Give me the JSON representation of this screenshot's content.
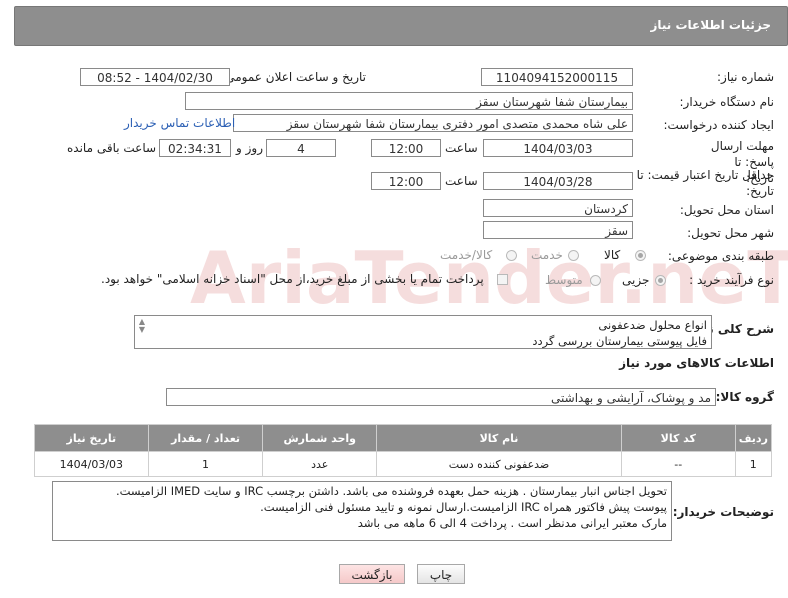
{
  "header": {
    "title": "جزئیات اطلاعات نیاز"
  },
  "fields": {
    "need_number_label": "شماره نیاز:",
    "need_number": "1104094152000115",
    "announce_label": "تاریخ و ساعت اعلان عمومی:",
    "announce_value": "1404/02/30 - 08:52",
    "buyer_org_label": "نام دستگاه خریدار:",
    "buyer_org": "بیمارستان شفا شهرستان سقز",
    "creator_label": "ایجاد کننده درخواست:",
    "creator": "علی شاه محمدی متصدی امور دفتری بیمارستان شفا شهرستان سقز",
    "buyer_contact_link": "اطلاعات تماس خریدار",
    "reply_deadline_label": "مهلت ارسال پاسخ: تا تاریخ:",
    "reply_date": "1404/03/03",
    "time_label": "ساعت",
    "reply_time": "12:00",
    "days_value": "4",
    "days_label": "روز و",
    "remaining_time": "02:34:31",
    "remaining_label": "ساعت باقی مانده",
    "price_validity_label": "حداقل تاریخ اعتبار قیمت: تا تاریخ:",
    "price_date": "1404/03/28",
    "price_time": "12:00",
    "province_label": "استان محل تحویل:",
    "province": "کردستان",
    "city_label": "شهر محل تحویل:",
    "city": "سقز",
    "category_label": "طبقه بندی موضوعی:",
    "category_options": [
      "کالا",
      "خدمت",
      "کالا/خدمت"
    ],
    "purchase_type_label": "نوع فرآیند خرید :",
    "purchase_options": [
      "جزیی",
      "متوسط"
    ],
    "payment_note": "پرداخت تمام یا بخشی از مبلغ خرید،از محل \"اسناد خزانه اسلامی\" خواهد بود."
  },
  "summary": {
    "label": "شرح کلی نیاز:",
    "lines": [
      "انواع محلول ضدعفونی",
      "فایل پیوستی بیمارستان بررسی گردد"
    ]
  },
  "goods_section": {
    "title": "اطلاعات کالاهای مورد نیاز",
    "group_label": "گروه کالا:",
    "group_value": "مد و پوشاک، آرایشی و بهداشتی"
  },
  "table": {
    "headers": [
      "ردیف",
      "کد کالا",
      "نام کالا",
      "واحد شمارش",
      "تعداد / مقدار",
      "تاریخ نیاز"
    ],
    "rows": [
      [
        "1",
        "--",
        "ضدعفونی کننده دست",
        "عدد",
        "1",
        "1404/03/03"
      ]
    ]
  },
  "buyer_notes": {
    "label": "توضیحات خریدار:",
    "lines": [
      "تحویل اجناس  انبار بیمارستان . هزینه حمل بعهده فروشنده می باشد.  داشتن برچسب IRC  و سایت  IMED  الزامیست.",
      "پیوست پیش فاکتور همراه IRC  الزامیست.ارسال نمونه و تایید مسئول فنی الزامیست.",
      " مارک معتبر ایرانی مدنظر است . پرداخت 4 الی 6 ماهه می باشد"
    ]
  },
  "buttons": {
    "print": "چاپ",
    "back": "بازگشت"
  },
  "watermark": {
    "text": "AriaTender.neT"
  },
  "colors": {
    "header_bg": "#8e8e8e",
    "link": "#2b5fb4",
    "back_button": "#f5c9c9"
  }
}
